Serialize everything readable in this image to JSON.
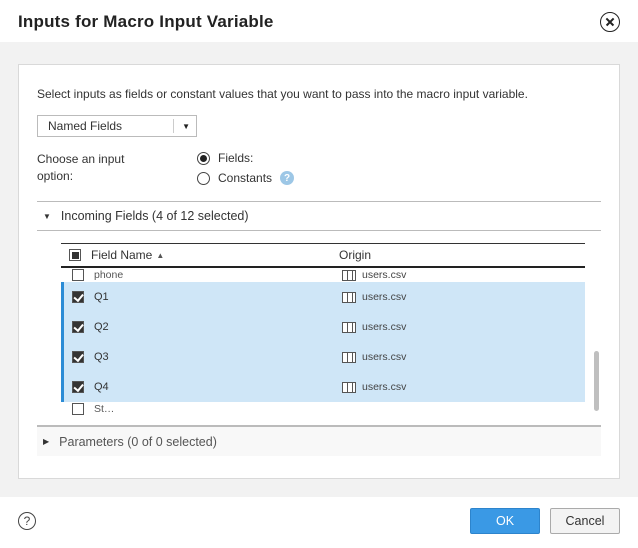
{
  "title": "Inputs for Macro Input Variable",
  "intro": "Select inputs as fields or constant values that you want to pass into the macro input variable.",
  "selector": {
    "value": "Named Fields"
  },
  "option_label": "Choose an input option:",
  "radios": {
    "fields": {
      "label": "Fields:",
      "selected": true
    },
    "constants": {
      "label": "Constants",
      "selected": false
    }
  },
  "incoming": {
    "heading": "Incoming Fields (4 of 12 selected)",
    "columns": {
      "name": "Field Name",
      "origin": "Origin"
    },
    "rows": [
      {
        "name": "phone",
        "origin": "users.csv",
        "selected": false,
        "truncated": true
      },
      {
        "name": "Q1",
        "origin": "users.csv",
        "selected": true
      },
      {
        "name": "Q2",
        "origin": "users.csv",
        "selected": true
      },
      {
        "name": "Q3",
        "origin": "users.csv",
        "selected": true
      },
      {
        "name": "Q4",
        "origin": "users.csv",
        "selected": true
      },
      {
        "name": "St…",
        "origin": "",
        "selected": false,
        "truncated": true
      }
    ]
  },
  "parameters": {
    "heading": "Parameters (0 of 0 selected)"
  },
  "buttons": {
    "ok": "OK",
    "cancel": "Cancel"
  }
}
